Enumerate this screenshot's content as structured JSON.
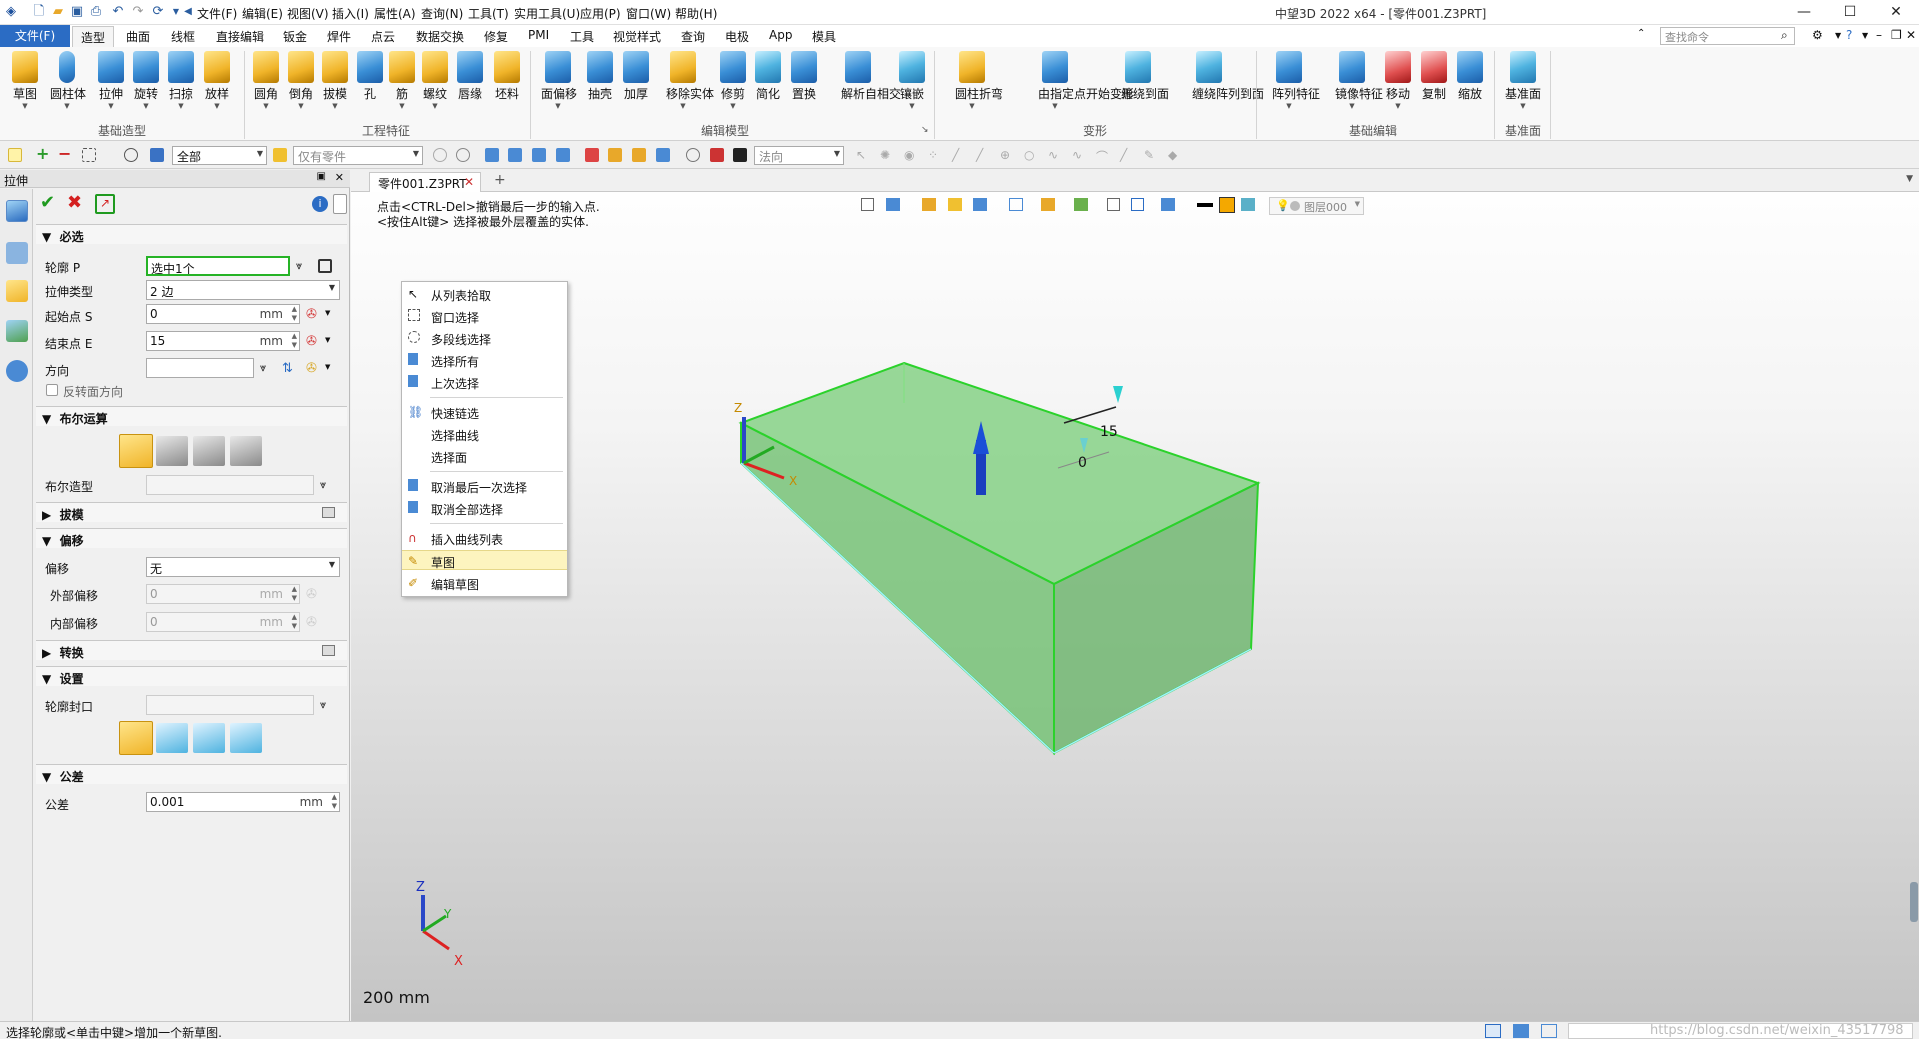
{
  "title_bar": {
    "menus": [
      "文件(F)",
      "编辑(E)",
      "视图(V)",
      "插入(I)",
      "属性(A)",
      "查询(N)",
      "工具(T)",
      "实用工具(U)",
      "应用(P)",
      "窗口(W)",
      "帮助(H)"
    ],
    "window_title": "中望3D 2022 x64 - [零件001.Z3PRT]",
    "win_buttons": [
      "—",
      "☐",
      "✕"
    ]
  },
  "ribbon_tabs": {
    "file": "文件(F)",
    "tabs": [
      "造型",
      "曲面",
      "线框",
      "直接编辑",
      "钣金",
      "焊件",
      "点云",
      "数据交换",
      "修复",
      "PMI",
      "工具",
      "视觉样式",
      "查询",
      "电极",
      "App",
      "模具"
    ],
    "active": "造型",
    "search_placeholder": "查找命令"
  },
  "ribbon": {
    "groups": [
      {
        "label": "基础造型",
        "buttons": [
          "草图",
          "圆柱体",
          "拉伸",
          "旋转",
          "扫掠",
          "放样"
        ]
      },
      {
        "label": "工程特征",
        "buttons": [
          "圆角",
          "倒角",
          "拔模",
          "孔",
          "筋",
          "螺纹",
          "唇缘",
          "坯料"
        ]
      },
      {
        "label": "编辑模型",
        "buttons": [
          "面偏移",
          "抽壳",
          "加厚",
          "移除实体",
          "修剪",
          "简化",
          "置换",
          "解析自相交",
          "镶嵌"
        ]
      },
      {
        "label": "变形",
        "buttons": [
          "圆柱折弯",
          "由指定点开始变形",
          "缠绕到面",
          "缠绕阵列到面"
        ]
      },
      {
        "label": "基础编辑",
        "buttons": [
          "阵列特征",
          "镜像特征",
          "移动",
          "复制",
          "缩放"
        ]
      },
      {
        "label": "基准面",
        "buttons": [
          "基准面"
        ]
      }
    ]
  },
  "toolbar": {
    "filter_value": "全部",
    "part_value": "仅有零件",
    "direction_value": "法向"
  },
  "left_panel": {
    "title": "拉伸",
    "sections": {
      "required": "必选",
      "boolean": "布尔运算",
      "draft": "拔模",
      "offset": "偏移",
      "transform": "转换",
      "settings": "设置",
      "tolerance": "公差"
    },
    "fields": {
      "profile_label": "轮廓 P",
      "profile_value": "选中1个",
      "extrude_type_label": "拉伸类型",
      "extrude_type_value": "2 边",
      "start_label": "起始点 S",
      "start_value": "0",
      "end_label": "结束点 E",
      "end_value": "15",
      "direction_label": "方向",
      "reverse_label": "反转面方向",
      "boolean_shape_label": "布尔造型",
      "offset_label": "偏移",
      "offset_value": "无",
      "outer_offset_label": "外部偏移",
      "outer_offset_value": "0",
      "inner_offset_label": "内部偏移",
      "inner_offset_value": "0",
      "profile_cap_label": "轮廓封口",
      "tolerance_label": "公差",
      "tolerance_value": "0.001",
      "unit": "mm"
    }
  },
  "viewport": {
    "doc_tab": "零件001.Z3PRT",
    "hint_line1": "点击<CTRL-Del>撤销最后一步的输入点.",
    "hint_line2": "<按住Alt键> 选择被最外层覆盖的实体.",
    "layer": "图层000",
    "dim_end": "15",
    "dim_start": "0",
    "scale": "200 mm",
    "axis_z": "Z",
    "axis_y": "Y",
    "axis_x": "X"
  },
  "context_menu": {
    "items": [
      "从列表拾取",
      "窗口选择",
      "多段线选择",
      "选择所有",
      "上次选择",
      "快速链选",
      "选择曲线",
      "选择面",
      "取消最后一次选择",
      "取消全部选择",
      "插入曲线列表",
      "草图",
      "编辑草图"
    ],
    "highlighted": "草图"
  },
  "status_bar": {
    "text": "选择轮廓或<单击中键>增加一个新草图.",
    "watermark": "https://blog.csdn.net/weixin_43517798"
  }
}
